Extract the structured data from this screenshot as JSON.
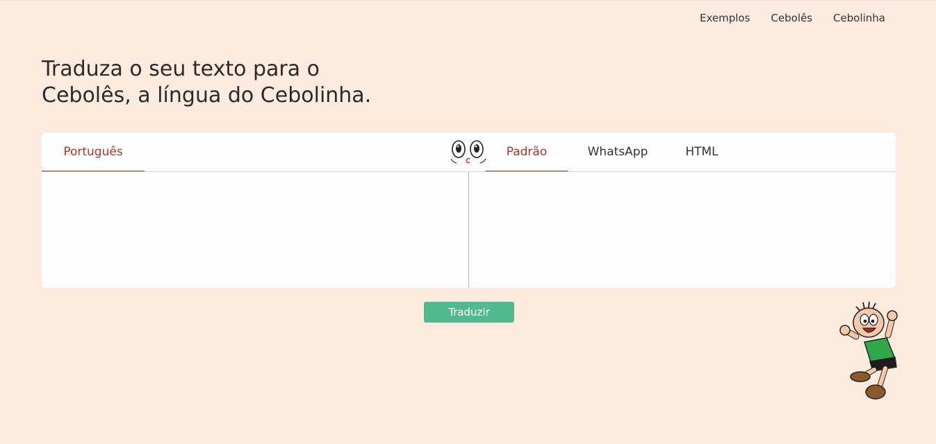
{
  "nav": {
    "items": [
      "Exemplos",
      "Cebolês",
      "Cebolinha"
    ]
  },
  "hero": {
    "line1": "Traduza o seu texto para o",
    "line2": "Cebolês, a língua do Cebolinha."
  },
  "translator": {
    "source_tab": "Português",
    "output_tabs": [
      "Padrão",
      "WhatsApp",
      "HTML"
    ],
    "active_output_tab": "Padrão",
    "source_value": "",
    "output_value": ""
  },
  "actions": {
    "translate_label": "Traduzir"
  },
  "colors": {
    "background": "#fdebe0",
    "accent_tab": "#a23c2a",
    "button": "#52b98e",
    "panel": "#fdfdfd"
  },
  "icons": {
    "face": "cebolinha-eyes-icon",
    "mascot": "cebolinha-character"
  }
}
